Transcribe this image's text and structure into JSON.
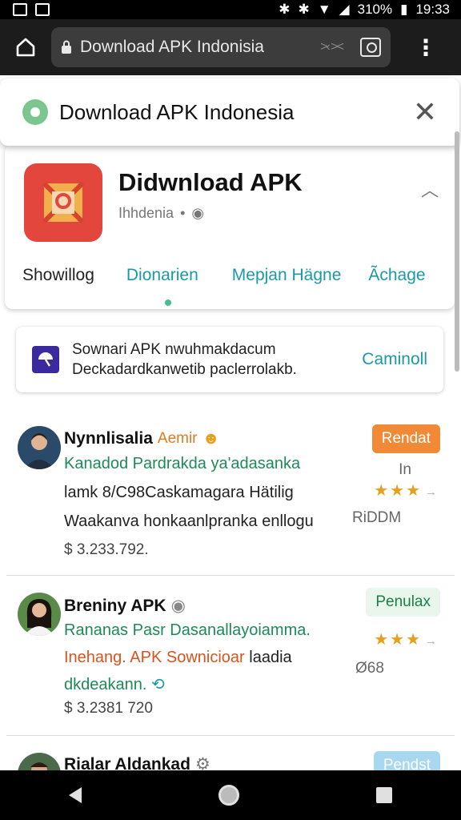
{
  "status_bar": {
    "battery": "310%",
    "time": "19:33"
  },
  "browser": {
    "url": "Download APK Indonisia",
    "arrows": ">‹ ><"
  },
  "site_header": {
    "title": "Download APK Indonesia"
  },
  "app": {
    "title": "Didwnload APK",
    "subtitle": "Ihhdenia",
    "tabs": [
      "Showillog",
      "Dionarien",
      "Mepjan Hägne",
      "Ãchage"
    ]
  },
  "banner": {
    "line1": "Sownari APK nwuhmakdacum",
    "line2": "Deckadardkanwetib paclerrolakb.",
    "action": "Caminoll"
  },
  "listings": [
    {
      "name": "Nynnlisalia",
      "tag": "Aemir",
      "line1": "Kanadod Pardrakda ya'adasanka",
      "line2": "lamk 8/C98Caskamagara Hätilig",
      "line3": "Waakanva honkaanlpranka enllogu",
      "price": "$ 3.233.792.",
      "button": "Rendat",
      "side_top": "In",
      "stars": "★★★",
      "side_bottom": "RiDDM"
    },
    {
      "name": "Breniny APK",
      "line1": "Rananas Pasr Dasanallayoiamma.",
      "line2a": "Inehang. APK Sownicioar",
      "line2b": "laadia",
      "line3": "dkdeakann.",
      "price": "$ 3.2381 720",
      "button": "Penulax",
      "stars": "★★★",
      "side_bottom": "Ø68"
    },
    {
      "name": "Rialar Aldankad",
      "button": "Pendst"
    }
  ],
  "colors": {
    "accent_teal": "#1a9aa8",
    "accent_orange": "#f08a36",
    "text_green": "#1e8a55"
  }
}
